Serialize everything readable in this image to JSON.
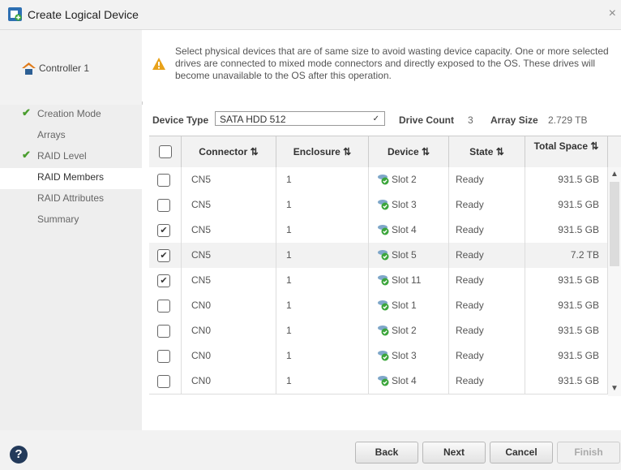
{
  "window": {
    "title": "Create Logical Device",
    "close": "×"
  },
  "sidebar": {
    "controller": "Controller 1",
    "steps": [
      {
        "label": "Creation Mode",
        "done": true
      },
      {
        "label": "Arrays",
        "done": false
      },
      {
        "label": "RAID Level",
        "done": true
      },
      {
        "label": "RAID Members",
        "done": false,
        "active": true
      },
      {
        "label": "RAID Attributes",
        "done": false
      },
      {
        "label": "Summary",
        "done": false
      }
    ]
  },
  "info": {
    "text": "Select physical devices that are of same size to avoid wasting device capacity. One or more selected drives are connected to mixed mode connectors and directly exposed to the OS. These drives will become unavailable to the OS after this operation."
  },
  "device": {
    "type_label": "Device Type",
    "type_value": "SATA HDD 512",
    "count_label": "Drive Count",
    "count_value": "3",
    "size_label": "Array Size",
    "size_value": "2.729 TB"
  },
  "table": {
    "headers": [
      "Connector ⇅",
      "Enclosure ⇅",
      "Device ⇅",
      "State ⇅",
      "Total Space ⇅"
    ],
    "rows": [
      {
        "checked": false,
        "connector": "CN5",
        "enclosure": "1",
        "device": "Slot 2",
        "state": "Ready",
        "space": "931.5 GB"
      },
      {
        "checked": false,
        "connector": "CN5",
        "enclosure": "1",
        "device": "Slot 3",
        "state": "Ready",
        "space": "931.5 GB"
      },
      {
        "checked": true,
        "connector": "CN5",
        "enclosure": "1",
        "device": "Slot 4",
        "state": "Ready",
        "space": "931.5 GB"
      },
      {
        "checked": true,
        "connector": "CN5",
        "enclosure": "1",
        "device": "Slot 5",
        "state": "Ready",
        "space": "7.2 TB"
      },
      {
        "checked": true,
        "connector": "CN5",
        "enclosure": "1",
        "device": "Slot 11",
        "state": "Ready",
        "space": "931.5 GB"
      },
      {
        "checked": false,
        "connector": "CN0",
        "enclosure": "1",
        "device": "Slot 1",
        "state": "Ready",
        "space": "931.5 GB"
      },
      {
        "checked": false,
        "connector": "CN0",
        "enclosure": "1",
        "device": "Slot 2",
        "state": "Ready",
        "space": "931.5 GB"
      },
      {
        "checked": false,
        "connector": "CN0",
        "enclosure": "1",
        "device": "Slot 3",
        "state": "Ready",
        "space": "931.5 GB"
      },
      {
        "checked": false,
        "connector": "CN0",
        "enclosure": "1",
        "device": "Slot 4",
        "state": "Ready",
        "space": "931.5 GB"
      }
    ]
  },
  "footer": {
    "back": "Back",
    "next": "Next",
    "cancel": "Cancel",
    "finish": "Finish",
    "help": "?"
  }
}
